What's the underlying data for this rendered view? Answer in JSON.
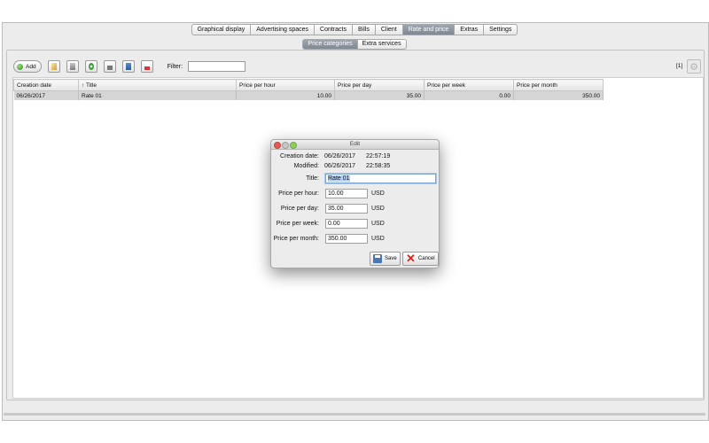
{
  "tabs": [
    "Graphical display",
    "Advertising spaces",
    "Contracts",
    "Bills",
    "Client",
    "Rate and price",
    "Extras",
    "Settings"
  ],
  "active_tab": "Rate and price",
  "subtabs": [
    "Price categories",
    "Extra services"
  ],
  "active_subtab": "Price categories",
  "toolbar": {
    "add_label": "Add",
    "filter_label": "Filter:",
    "filter_value": "",
    "icons": [
      "edit-icon",
      "delete-icon",
      "refresh-icon",
      "print-icon",
      "export-icon",
      "pdf-icon"
    ]
  },
  "page_indicator": "[1]",
  "table": {
    "columns": [
      "Creation date",
      "↑ Title",
      "Price per hour",
      "Price per day",
      "Price per week",
      "Price per month"
    ],
    "rows": [
      {
        "creation_date": "06/26/2017",
        "title": "Rate 01",
        "price_hour": "10.00",
        "price_day": "35.00",
        "price_week": "0.00",
        "price_month": "350.00"
      }
    ]
  },
  "dialog": {
    "title": "Edit",
    "creation_label": "Creation date:",
    "creation_date": "06/26/2017",
    "creation_time": "22:57:19",
    "modified_label": "Modified:",
    "modified_date": "06/26/2017",
    "modified_time": "22:58:35",
    "title_label": "Title:",
    "title_value": "Rate 01",
    "hour_label": "Price per hour:",
    "hour_value": "10.00",
    "day_label": "Price per day:",
    "day_value": "35.00",
    "week_label": "Price per week:",
    "week_value": "0.00",
    "month_label": "Price per month:",
    "month_value": "350.00",
    "currency": "USD",
    "save_label": "Save",
    "cancel_label": "Cancel"
  },
  "colors": {
    "accent_tab": "#8a929c",
    "row_selected": "#d5d5d5",
    "close_button": "#e65a50"
  }
}
